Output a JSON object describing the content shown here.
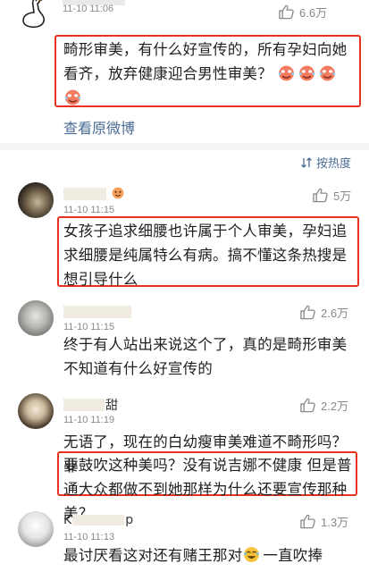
{
  "post": {
    "time": "11-10 11:06",
    "likes": "6.6万",
    "text": "畸形审美，有什么好宣传的，所有孕妇向她看齐，放弃健康迎合男性审美？",
    "link": "查看原微博"
  },
  "sort": {
    "label": "按热度"
  },
  "comments": [
    {
      "time": "11-10 11:15",
      "likes": "5万",
      "text": "女孩子追求细腰也许属于个人审美，孕妇追求细腰是纯属特么有病。搞不懂这条热搜是想引导什么"
    },
    {
      "time": "11-10 11:15",
      "likes": "2.6万",
      "text": "终于有人站出来说这个了，真的是畸形审美不知道有什么好宣传的"
    },
    {
      "name_fragment": "甜",
      "time": "11-10 11:19",
      "likes": "2.2万",
      "text_plain": "无语了，现在的白幼瘦审美难道不畸形吗？非",
      "text_boxed": "要鼓吹这种美吗？没有说吉娜不健康 但是普通大众都做不到她那样为什么还要宣传那种美？"
    },
    {
      "name_start": "K",
      "name_end": "p",
      "time": "11-10 11:13",
      "likes": "1.3万",
      "text_before": "最讨厌看这对还有赌王那对",
      "text_after": "一直吹捧"
    }
  ]
}
